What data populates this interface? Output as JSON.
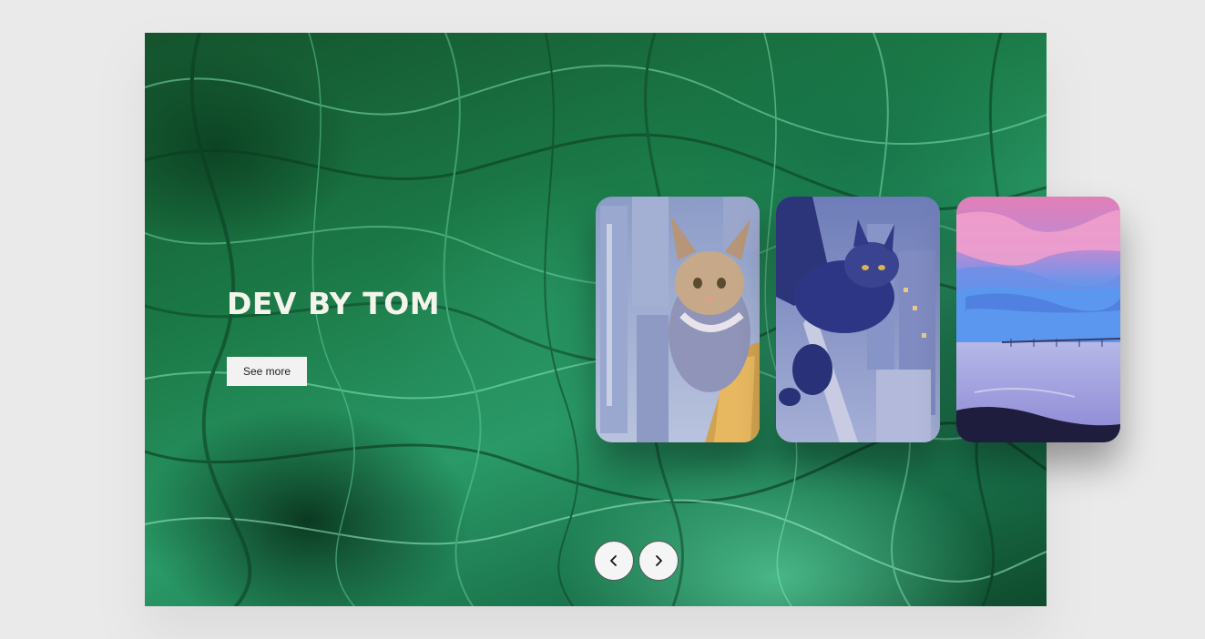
{
  "hero": {
    "title": "DEV BY TOM",
    "button_label": "See more"
  },
  "cards": [
    {
      "subject": "tabby cat on skyscraper ledge"
    },
    {
      "subject": "dark cat leaning over city"
    },
    {
      "subject": "pink sky over shoreline"
    }
  ],
  "navigation": {
    "prev_icon": "chevron-left-icon",
    "next_icon": "chevron-right-icon"
  },
  "colors": {
    "page_bg": "#eaeaea",
    "title_text": "#f4f4ec",
    "button_bg": "#f2f2f2",
    "hero_green": "#1b7a47"
  }
}
